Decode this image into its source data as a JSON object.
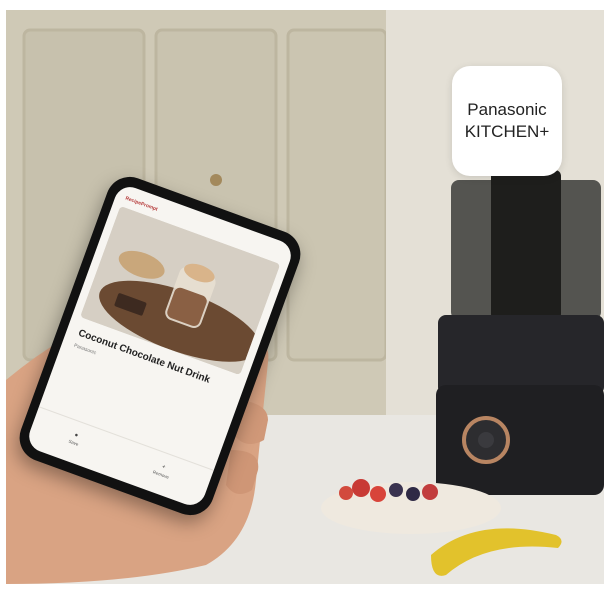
{
  "badge": {
    "brand": "Panasonic",
    "product": "KITCHEN+"
  },
  "phone": {
    "header_logo": "RecipePrompt",
    "recipe_title": "Coconut Chocolate Nut Drink",
    "recipe_source": "Panasonic",
    "recipe_description": "",
    "actions": [
      {
        "label": "Save",
        "icon": "bookmark-icon"
      },
      {
        "label": "Remove",
        "icon": "plus-icon"
      }
    ]
  }
}
